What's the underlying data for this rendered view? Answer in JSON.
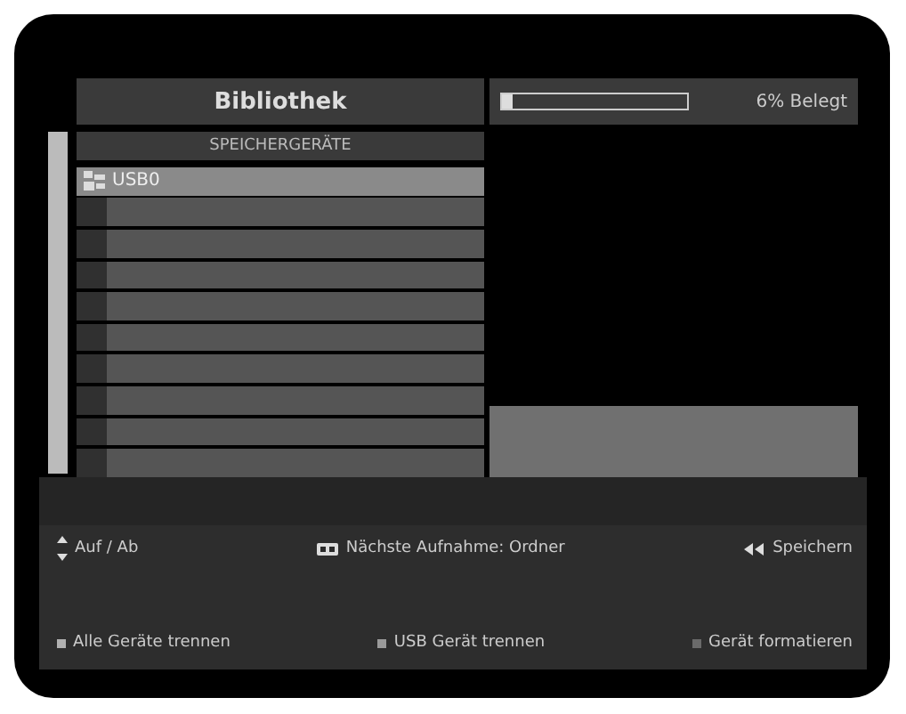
{
  "title": "Bibliothek",
  "storage": {
    "level": 0.06,
    "reading": "6% Belegt"
  },
  "list_header": "SPEICHERGERÄTE",
  "devices": [
    {
      "name": "USB0",
      "selected": true
    }
  ],
  "hints": [
    {
      "kind": "updown",
      "label": "Auf / Ab"
    },
    {
      "kind": "ok",
      "label": "Nächste Aufnahme: Ordner"
    },
    {
      "kind": "back",
      "label": "Speichern"
    }
  ],
  "actions": [
    {
      "label": "Alle Geräte trennen",
      "color": "#b0b0b0"
    },
    {
      "label": "USB Gerät trennen",
      "color": "#9a9a9a"
    },
    {
      "label": "Gerät formatieren",
      "color": "#6a6a6a"
    }
  ]
}
